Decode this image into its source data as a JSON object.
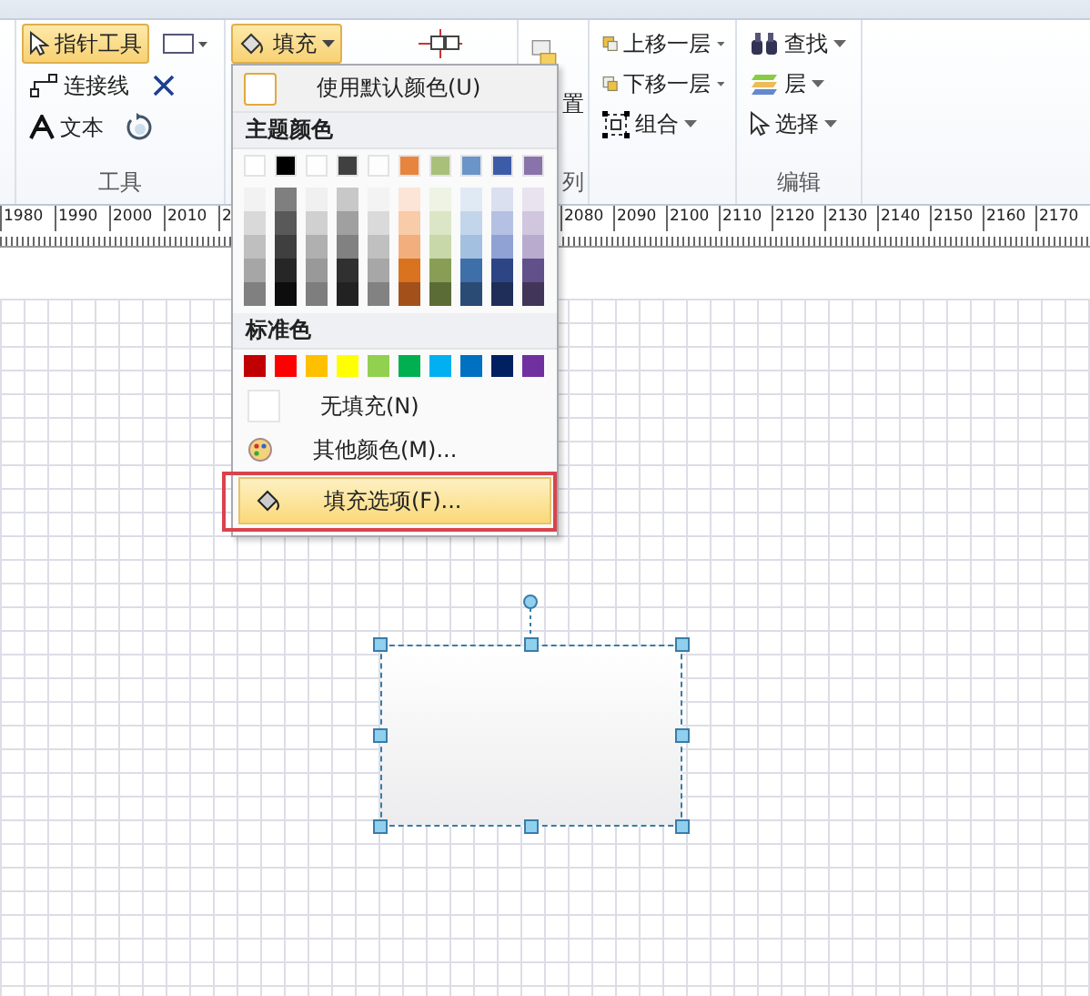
{
  "ribbon": {
    "tools_group": {
      "label": "工具",
      "pointer_tool": {
        "label": "指针工具",
        "selected": true
      },
      "connector": "连接线",
      "text": "文本"
    },
    "fill_button": {
      "label": "填充",
      "expanded": true
    },
    "arrange_group": {
      "label": "列",
      "partial_text": "置"
    },
    "order_items": [
      "上移一层",
      "下移一层",
      "组合"
    ],
    "edit_group": {
      "label": "编辑",
      "items": [
        "查找",
        "层",
        "选择"
      ]
    }
  },
  "ruler": {
    "left_labels": [
      "1980",
      "1990",
      "2000",
      "2010",
      "2"
    ],
    "right_labels": [
      "2080",
      "2090",
      "2100",
      "2110",
      "2120",
      "2130",
      "2140",
      "2150",
      "2160",
      "2170"
    ]
  },
  "fill_menu": {
    "default_color": "使用默认颜色(U)",
    "theme_header": "主题颜色",
    "theme_colors": [
      {
        "color": "#ffffff",
        "shades": [
          {
            "color": "#f2f2f2"
          },
          {
            "color": "#d9d9d9"
          },
          {
            "color": "#bfbfbf"
          },
          {
            "color": "#a6a6a6"
          },
          {
            "color": "#808080"
          }
        ]
      },
      {
        "color": "#000000",
        "shades": [
          {
            "color": "#7f7f7f"
          },
          {
            "color": "#595959"
          },
          {
            "color": "#3f3f3f"
          },
          {
            "color": "#262626"
          },
          {
            "color": "#0d0d0d"
          }
        ]
      },
      {
        "color": "#fefefe",
        "shades": [
          {
            "color": "#f0f0f0"
          },
          {
            "color": "#d0d0d0"
          },
          {
            "color": "#b0b0b0"
          },
          {
            "color": "#999999"
          },
          {
            "color": "#7e7e7e"
          }
        ]
      },
      {
        "color": "#404040",
        "shades": [
          {
            "color": "#c8c8c8"
          },
          {
            "color": "#a0a0a0"
          },
          {
            "color": "#818181"
          },
          {
            "color": "#303030"
          },
          {
            "color": "#222222"
          }
        ]
      },
      {
        "color": "#fdfdfd",
        "shades": [
          {
            "color": "#f3f3f3"
          },
          {
            "color": "#dadada"
          },
          {
            "color": "#c0c0c0"
          },
          {
            "color": "#a7a7a7"
          },
          {
            "color": "#828282"
          }
        ]
      },
      {
        "color": "#e8853d",
        "shades": [
          {
            "color": "#fce4d6"
          },
          {
            "color": "#f8cba9"
          },
          {
            "color": "#f3ae7e"
          },
          {
            "color": "#d9731f"
          },
          {
            "color": "#a4501a"
          }
        ]
      },
      {
        "color": "#a9c07a",
        "shades": [
          {
            "color": "#eef3e3"
          },
          {
            "color": "#dbe6c6"
          },
          {
            "color": "#c8d8a8"
          },
          {
            "color": "#889e55"
          },
          {
            "color": "#5b6c36"
          }
        ]
      },
      {
        "color": "#6b95c8",
        "shades": [
          {
            "color": "#e0eaf5"
          },
          {
            "color": "#c2d5eb"
          },
          {
            "color": "#a4c0e0"
          },
          {
            "color": "#3e6fa8"
          },
          {
            "color": "#2a4b73"
          }
        ]
      },
      {
        "color": "#3d5ca8",
        "shades": [
          {
            "color": "#dae0f0"
          },
          {
            "color": "#b5c1e2"
          },
          {
            "color": "#8fa2d3"
          },
          {
            "color": "#2e4585"
          },
          {
            "color": "#1f2e58"
          }
        ]
      },
      {
        "color": "#8a73ab",
        "shades": [
          {
            "color": "#e8e3ef"
          },
          {
            "color": "#d0c7de"
          },
          {
            "color": "#b9abce"
          },
          {
            "color": "#62508a"
          },
          {
            "color": "#413559"
          }
        ]
      }
    ],
    "standard_header": "标准色",
    "standard_colors": [
      {
        "color": "#c00000"
      },
      {
        "color": "#ff0000"
      },
      {
        "color": "#ffc000"
      },
      {
        "color": "#ffff00"
      },
      {
        "color": "#92d050"
      },
      {
        "color": "#00b050"
      },
      {
        "color": "#00b0f0"
      },
      {
        "color": "#0070c0"
      },
      {
        "color": "#002060"
      },
      {
        "color": "#7030a0"
      }
    ],
    "no_fill": "无填充(N)",
    "more_colors": "其他颜色(M)...",
    "fill_options": {
      "label": "填充选项(F)...",
      "selected": true
    }
  }
}
